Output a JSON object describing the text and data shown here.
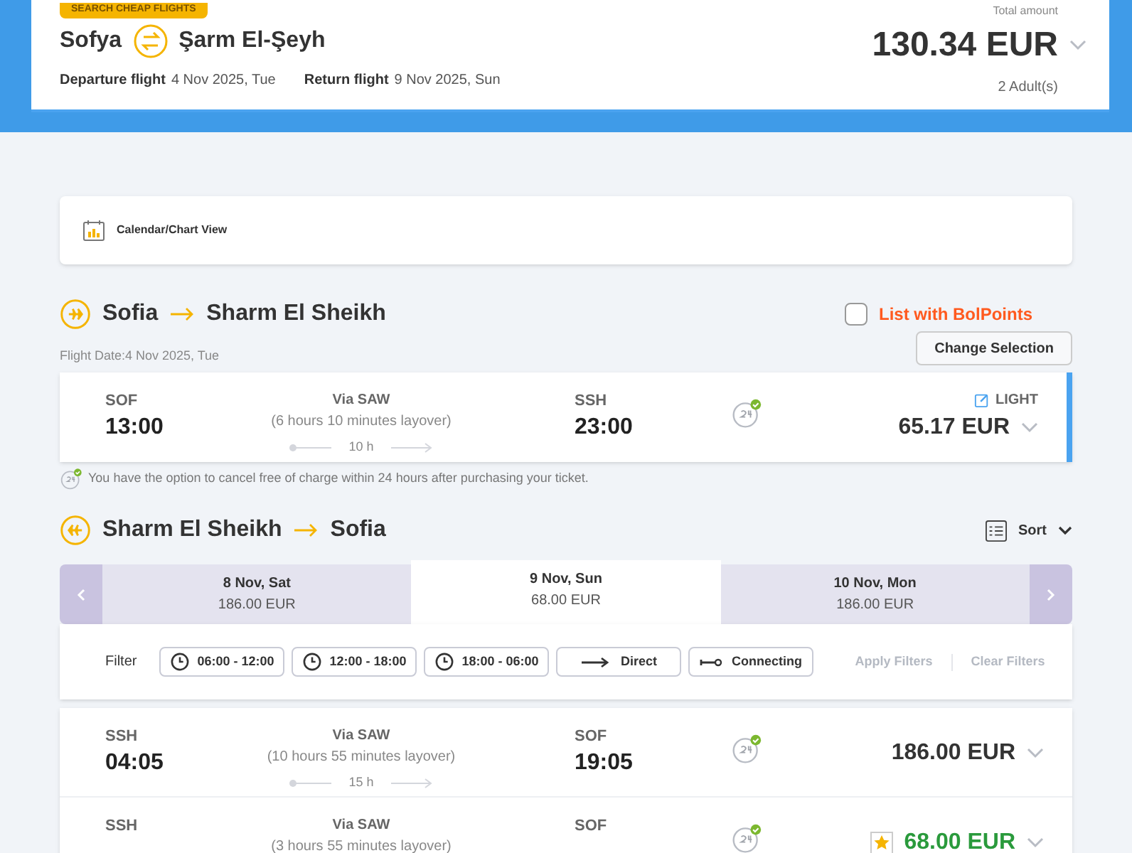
{
  "header": {
    "badge": "SEARCH CHEAP FLIGHTS",
    "from": "Sofya",
    "to": "Şarm El-Şeyh",
    "departure_label": "Departure flight",
    "departure_date": "4 Nov 2025, Tue",
    "return_label": "Return flight",
    "return_date": "9 Nov 2025, Sun",
    "total_label": "Total amount",
    "total": "130.34 EUR",
    "passengers": "2 Adult(s)"
  },
  "calendar_view": {
    "label": "Calendar/Chart View"
  },
  "outbound": {
    "from": "Sofia",
    "to": "Sharm El Sheikh",
    "flight_date": "Flight Date:4 Nov 2025, Tue",
    "bolpoints": {
      "label": "List with BolPoints",
      "checked": false
    },
    "change_button": "Change Selection",
    "flights": [
      {
        "dep_code": "SOF",
        "dep_time": "13:00",
        "via": "Via SAW",
        "layover": "(6 hours 10 minutes layover)",
        "duration": "10 h",
        "arr_code": "SSH",
        "arr_time": "23:00",
        "fare": "LIGHT",
        "price": "65.17 EUR",
        "cheapest": false,
        "selected": true
      }
    ],
    "note": "You have the option to cancel free of charge within 24 hours after purchasing your ticket."
  },
  "return": {
    "from": "Sharm El Sheikh",
    "to": "Sofia",
    "sort": "Sort",
    "dates": [
      {
        "date": "8 Nov, Sat",
        "price": "186.00 EUR",
        "selected": false
      },
      {
        "date": "9 Nov, Sun",
        "price": "68.00 EUR",
        "selected": true
      },
      {
        "date": "10 Nov, Mon",
        "price": "186.00 EUR",
        "selected": false
      }
    ],
    "filter_label": "Filter",
    "filters": [
      {
        "kind": "time",
        "label": "06:00 - 12:00"
      },
      {
        "kind": "time",
        "label": "12:00 - 18:00"
      },
      {
        "kind": "time",
        "label": "18:00 - 06:00"
      },
      {
        "kind": "direct",
        "label": "Direct"
      },
      {
        "kind": "connecting",
        "label": "Connecting"
      }
    ],
    "apply": {
      "label": "Apply Filters",
      "disabled": true
    },
    "clear": {
      "label": "Clear Filters",
      "disabled": true
    },
    "flights": [
      {
        "dep_code": "SSH",
        "dep_time": "04:05",
        "via": "Via SAW",
        "layover": "(10 hours 55 minutes layover)",
        "duration": "15 h",
        "arr_code": "SOF",
        "arr_time": "19:05",
        "price": "186.00 EUR",
        "cheapest": false,
        "selected": false
      },
      {
        "dep_code": "SSH",
        "via": "Via SAW",
        "layover": "(3 hours 55 minutes layover)",
        "arr_code": "SOF",
        "price": "68.00 EUR",
        "cheapest": true,
        "selected": false
      }
    ]
  }
}
